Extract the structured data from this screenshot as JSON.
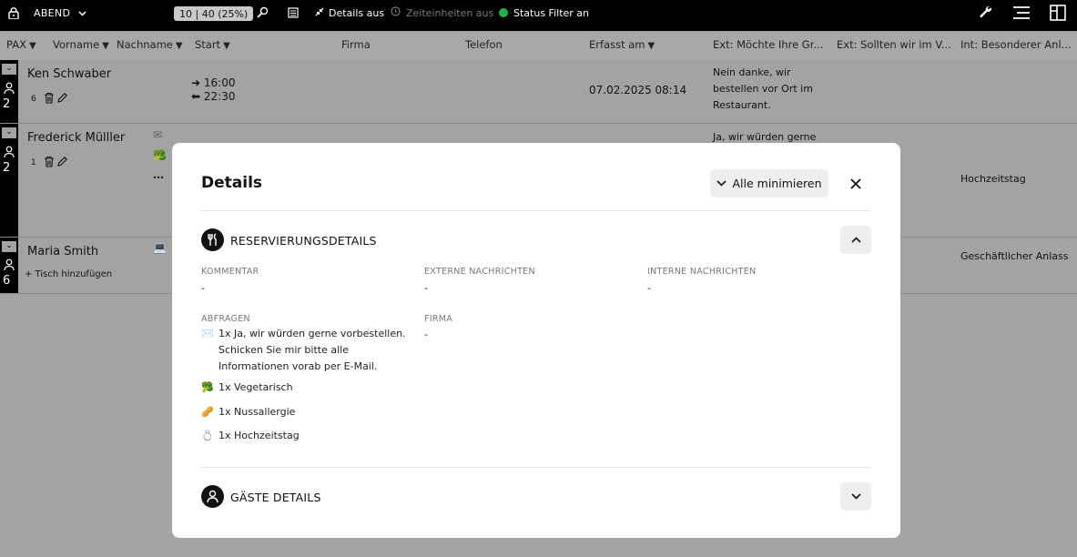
{
  "topbar": {
    "shift": "ABEND",
    "counter": "10 | 40 (25%)",
    "details_off": "Details aus",
    "time_units_off": "Zeiteinheiten aus",
    "status_filter": "Status Filter an",
    "status_color": "#22b24c"
  },
  "table": {
    "columns": [
      {
        "label": "PAX",
        "sortable": true
      },
      {
        "label": "Vorname",
        "sortable": true
      },
      {
        "label": "Nachname",
        "sortable": true
      },
      {
        "label": "Start",
        "sortable": true
      },
      {
        "label": "Firma",
        "sortable": false
      },
      {
        "label": "Telefon",
        "sortable": false
      },
      {
        "label": "Erfasst am",
        "sortable": true
      },
      {
        "label": "Ext: Möchte Ihre Gr...",
        "sortable": false
      },
      {
        "label": "Ext: Sollten wir im V...",
        "sortable": false
      },
      {
        "label": "Int: Besonderer Anl...",
        "sortable": false
      }
    ],
    "rows": [
      {
        "name": "Ken Schwaber",
        "pax": "2",
        "table_no": "6",
        "arrival": "16:00",
        "departure": "22:30",
        "created": "07.02.2025 08:14",
        "ext1": "Nein danke, wir bestellen vor Ort im Restaurant.",
        "int": ""
      },
      {
        "name": "Frederick Mülller",
        "pax": "2",
        "table_no": "1",
        "ext1": "Ja, wir würden gerne",
        "int": "Hochzeitstag"
      },
      {
        "name": "Maria Smith",
        "pax": "6",
        "add_table": "Tisch hinzufügen",
        "int": "Geschäftlicher Anlass"
      }
    ]
  },
  "modal": {
    "title": "Details",
    "minimize_all": "Alle minimieren",
    "section1": {
      "title": "RESERVIERUNGSDETAILS",
      "comment_label": "KOMMENTAR",
      "comment": "-",
      "ext_msg_label": "EXTERNE NACHRICHTEN",
      "ext_msg": "-",
      "int_msg_label": "INTERNE NACHRICHTEN",
      "int_msg": "-",
      "queries_label": "ABFRAGEN",
      "queries": [
        {
          "icon": "✉️",
          "text": "1x Ja, wir würden gerne vorbestellen. Schicken Sie mir bitte alle Informationen vorab per E-Mail."
        },
        {
          "icon": "🥦",
          "text": "1x Vegetarisch"
        },
        {
          "icon": "🥜",
          "text": "1x Nussallergie"
        },
        {
          "icon": "💍",
          "text": "1x Hochzeitstag"
        }
      ],
      "company_label": "FIRMA",
      "company": "-"
    },
    "section2": {
      "title": "GÄSTE DETAILS"
    }
  }
}
